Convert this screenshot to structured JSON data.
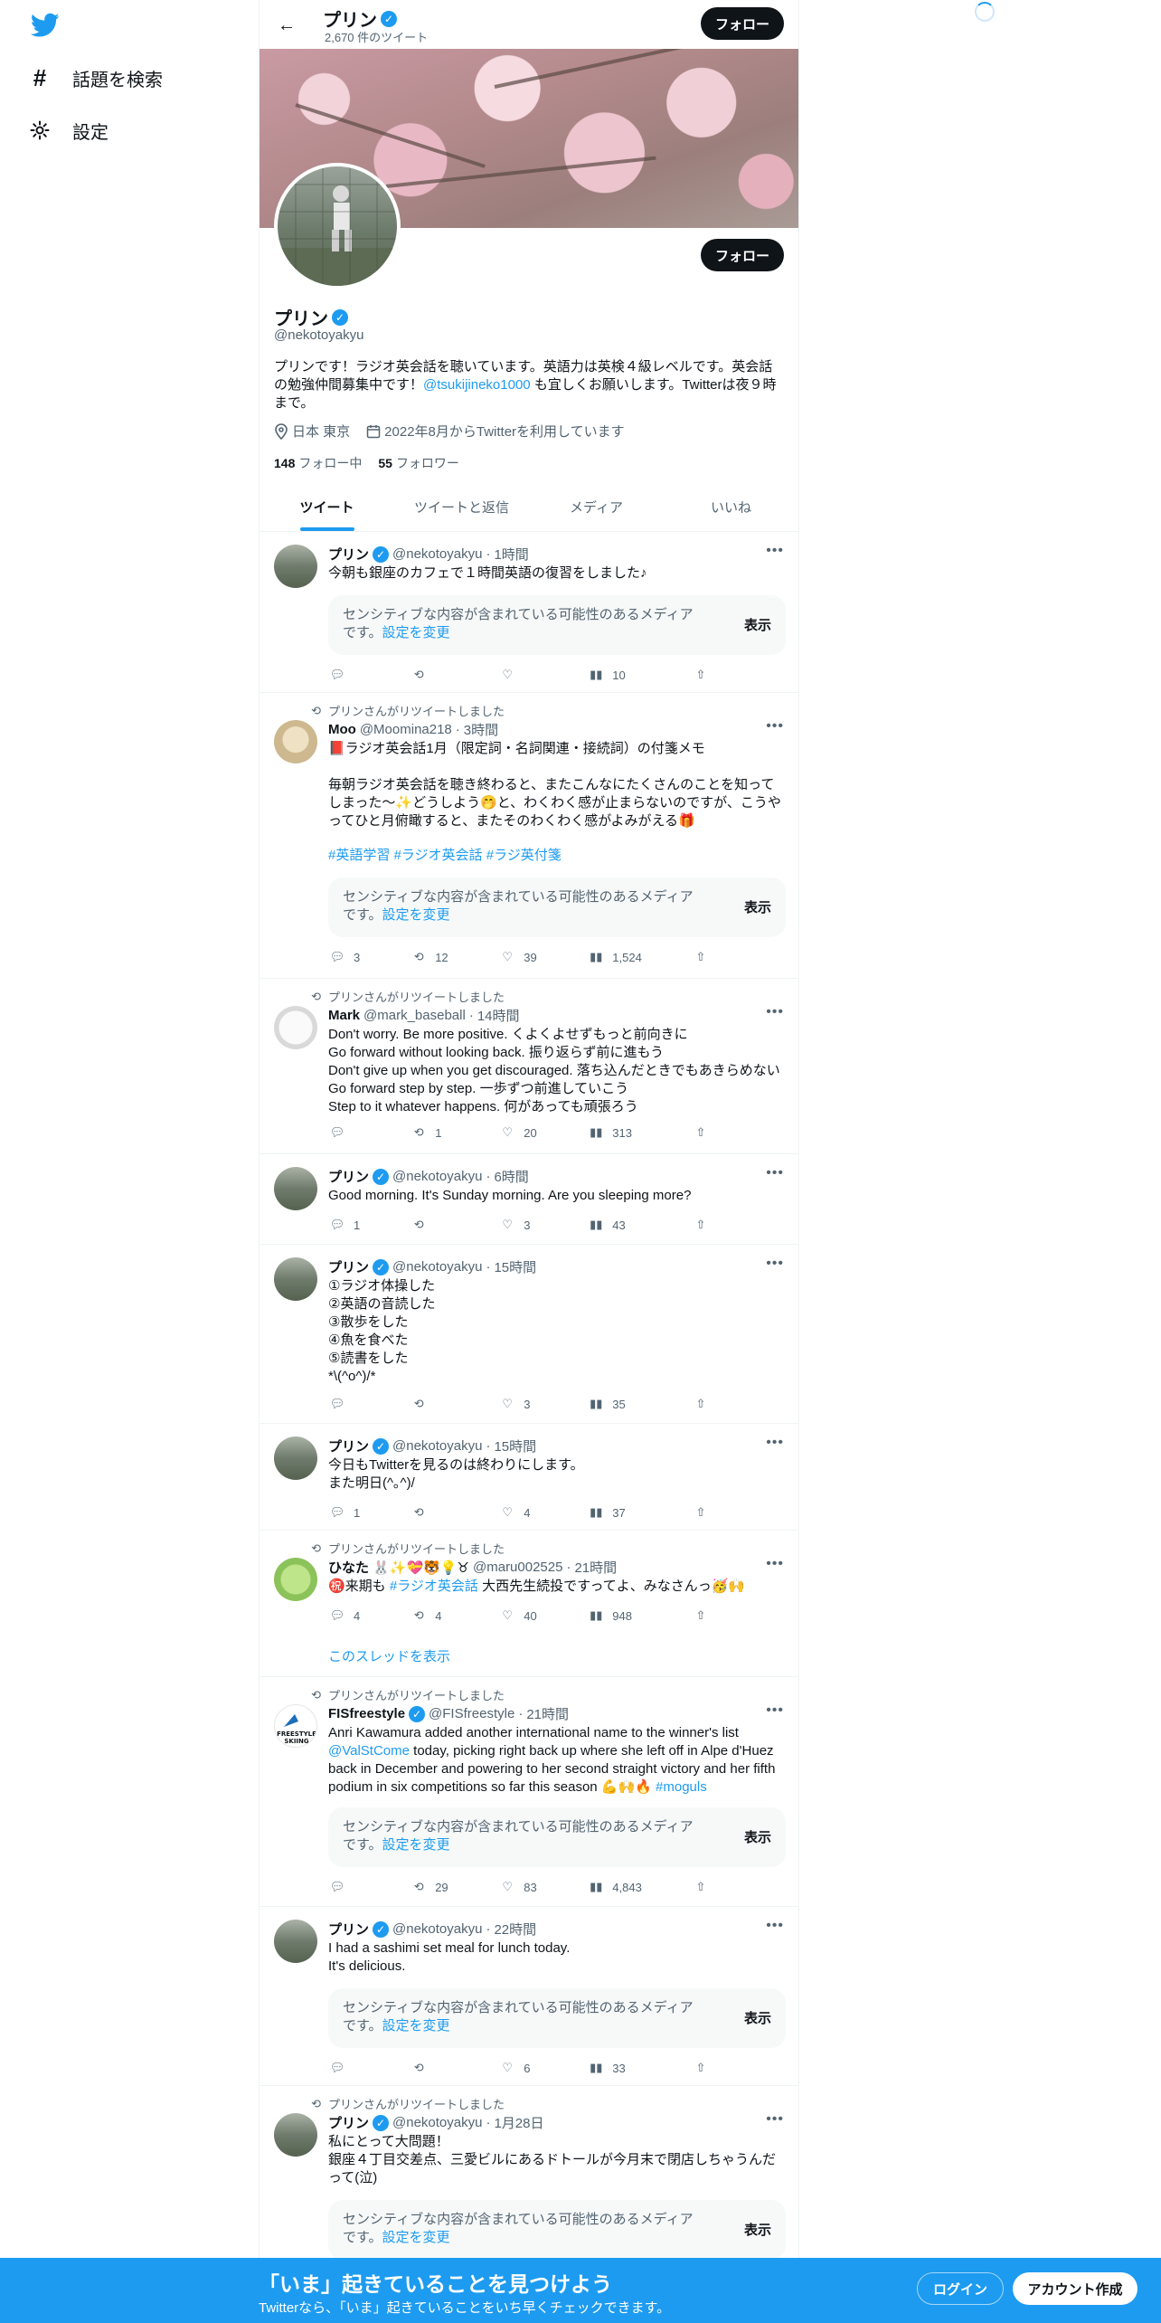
{
  "sidebar": {
    "logo_icon": "twitter-bird-icon",
    "items": [
      {
        "icon": "hashtag-icon",
        "label": "話題を検索"
      },
      {
        "icon": "gear-icon",
        "label": "設定"
      }
    ]
  },
  "header": {
    "name": "プリン",
    "tweet_count": "2,670 件のツイート",
    "follow_label": "フォロー"
  },
  "profile": {
    "name": "プリン",
    "handle": "@nekotoyakyu",
    "follow_label": "フォロー",
    "bio_before": "プリンです！ラジオ英会話を聴いています。英語力は英検４級レベルです。英会話の勉強仲間募集中です！",
    "bio_link": "@tsukijineko1000",
    "bio_after": " も宜しくお願いします。Twitterは夜９時まで。",
    "location": "日本 東京",
    "joined": "2022年8月からTwitterを利用しています",
    "following_count": "148",
    "following_label": "フォロー中",
    "followers_count": "55",
    "followers_label": "フォロワー"
  },
  "tabs": [
    "ツイート",
    "ツイートと返信",
    "メディア",
    "いいね"
  ],
  "sensitive": {
    "text": "センシティブな内容が含まれている可能性のあるメディアです。",
    "link": "設定を変更",
    "button": "表示"
  },
  "tweets": [
    {
      "name": "プリン",
      "handle": "@nekotoyakyu",
      "time": "1時間",
      "text": "今朝も銀座のカフェで１時間英語の復習をしました♪",
      "reply": "",
      "retweet": "",
      "like": "",
      "views": "10"
    },
    {
      "retweet_by": "プリンさんがリツイートしました",
      "name": "Moo",
      "handle": "@Moomina218",
      "time": "3時間",
      "text": "📕ラジオ英会話1月（限定詞・名詞関連・接続詞）の付箋メモ\n\n毎朝ラジオ英会話を聴き終わると、またこんなにたくさんのことを知ってしまった〜✨どうしよう🤭と、わくわく感が止まらないのですが、こうやってひと月俯瞰すると、またそのわくわく感がよみがえる🎁",
      "hashtags": "#英語学習 #ラジオ英会話 #ラジ英付箋",
      "reply": "3",
      "retweet": "12",
      "like": "39",
      "views": "1,524"
    },
    {
      "retweet_by": "プリンさんがリツイートしました",
      "name": "Mark",
      "handle": "@mark_baseball",
      "time": "14時間",
      "text": "Don't worry. Be more positive. くよくよせずもっと前向きに\nGo forward without looking back. 振り返らず前に進もう\nDon't give up when you get discouraged. 落ち込んだときでもあきらめない\nGo forward step by step. 一歩ずつ前進していこう\nStep to it whatever happens. 何があっても頑張ろう",
      "reply": "",
      "retweet": "1",
      "like": "20",
      "views": "313"
    },
    {
      "name": "プリン",
      "handle": "@nekotoyakyu",
      "time": "6時間",
      "text": "Good morning. It's Sunday morning.  Are you sleeping more?",
      "reply": "1",
      "retweet": "",
      "like": "3",
      "views": "43"
    },
    {
      "name": "プリン",
      "handle": "@nekotoyakyu",
      "time": "15時間",
      "text": "①ラジオ体操した\n②英語の音読した\n③散歩をした\n④魚を食べた\n⑤読書をした\n*\\(^o^)/*",
      "reply": "",
      "retweet": "",
      "like": "3",
      "views": "35"
    },
    {
      "name": "プリン",
      "handle": "@nekotoyakyu",
      "time": "15時間",
      "text": "今日もTwitterを見るのは終わりにします。\nまた明日(^｡^)/",
      "reply": "1",
      "retweet": "",
      "like": "4",
      "views": "37"
    },
    {
      "retweet_by": "プリンさんがリツイートしました",
      "name": "ひなた 🐰✨💝🐯💡♉",
      "handle": "@maru002525",
      "time": "21時間",
      "text_before": "㊗️来期も ",
      "text_link": "#ラジオ英会話",
      "text_after": " 大西先生続投ですってよ、みなさんっ🥳🙌",
      "reply": "4",
      "retweet": "4",
      "like": "40",
      "views": "948",
      "thread": "このスレッドを表示"
    },
    {
      "retweet_by": "プリンさんがリツイートしました",
      "name": "FISfreestyle",
      "handle": "@FISfreestyle",
      "time": "21時間",
      "text_a": "Anri Kawamura added another international name to the winner's list ",
      "text_link1": "@ValStCome",
      "text_b": " today, picking right back up where she left off in Alpe d'Huez back in December and powering to her second straight victory and her fifth podium in six competitions so far this season 💪🙌🔥 ",
      "text_link2": "#moguls",
      "reply": "",
      "retweet": "29",
      "like": "83",
      "views": "4,843"
    },
    {
      "name": "プリン",
      "handle": "@nekotoyakyu",
      "time": "22時間",
      "text": "I had a sashimi set meal for lunch today.\nIt's delicious.",
      "reply": "",
      "retweet": "",
      "like": "6",
      "views": "33"
    },
    {
      "retweet_by": "プリンさんがリツイートしました",
      "name": "プリン",
      "handle": "@nekotoyakyu",
      "time": "1月28日",
      "text": "私にとって大問題！\n銀座４丁目交差点、三愛ビルにあるドトールが今月末で閉店しちゃうんだって(泣)"
    }
  ],
  "bottom_bar": {
    "title": "「いま」起きていることを見つけよう",
    "subtitle": "Twitterなら、「いま」起きていることをいち早くチェックできます。",
    "login": "ログイン",
    "signup": "アカウント作成"
  },
  "colors": {
    "accent": "#1d9bf0",
    "text": "#0f1419",
    "muted": "#536471",
    "button_dark": "#0f1419"
  }
}
